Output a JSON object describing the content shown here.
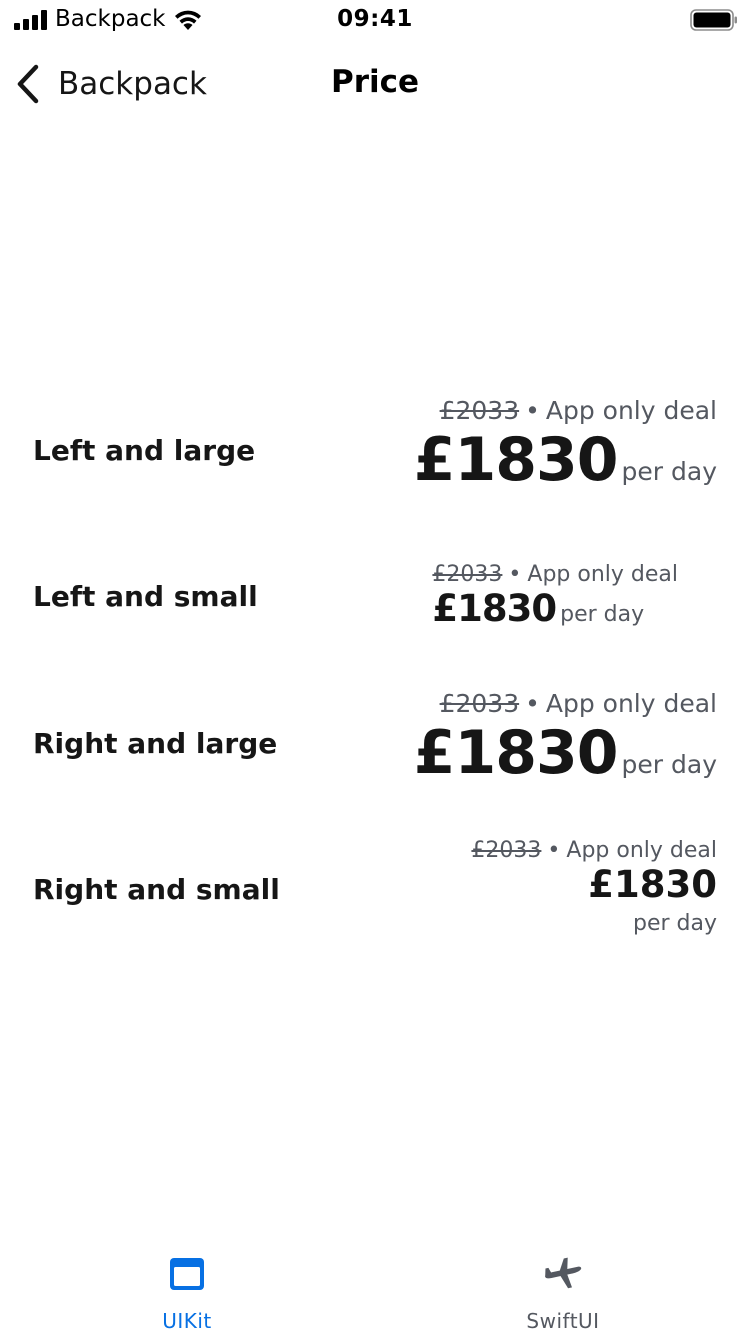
{
  "status_bar": {
    "carrier": "Backpack",
    "time": "09:41"
  },
  "nav": {
    "back_label": "Backpack",
    "title": "Price"
  },
  "rows": [
    {
      "label": "Left and large",
      "previous_price": "£2033",
      "separator": "•",
      "deal": "App only deal",
      "price": "£1830",
      "period": "per day"
    },
    {
      "label": "Left and small",
      "previous_price": "£2033",
      "separator": "•",
      "deal": "App only deal",
      "price": "£1830",
      "period": "per day"
    },
    {
      "label": "Right and large",
      "previous_price": "£2033",
      "separator": "•",
      "deal": "App only deal",
      "price": "£1830",
      "period": "per day"
    },
    {
      "label": "Right and small",
      "previous_price": "£2033",
      "separator": "•",
      "deal": "App only deal",
      "price": "£1830",
      "period": "per day"
    }
  ],
  "tab_bar": {
    "tabs": [
      {
        "label": "UIKit",
        "icon": "window-icon",
        "selected": true
      },
      {
        "label": "SwiftUI",
        "icon": "airplane-icon",
        "selected": false
      }
    ]
  },
  "colors": {
    "accent": "#0770e3",
    "text_primary": "#161616",
    "text_secondary": "#545860"
  }
}
